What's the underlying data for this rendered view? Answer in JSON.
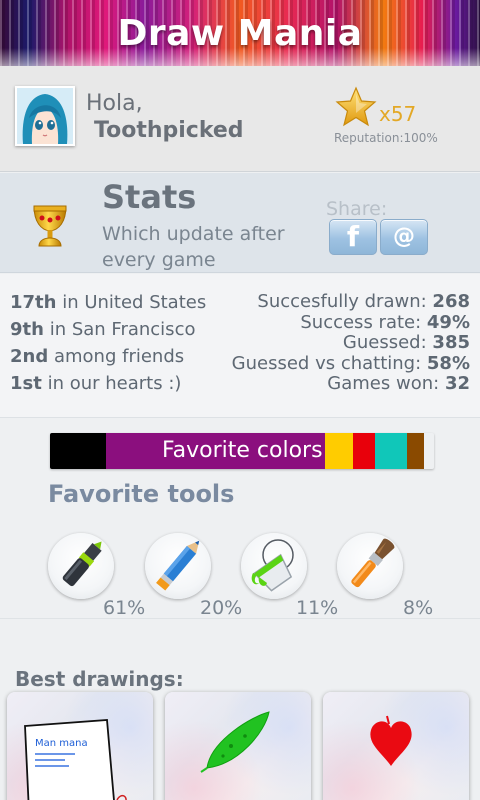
{
  "app": {
    "title": "Draw Mania"
  },
  "profile": {
    "greeting": "Hola,",
    "username": "Toothpicked",
    "reputation_count": "x57",
    "reputation_label": "Reputation:100%"
  },
  "stats": {
    "title": "Stats",
    "subtitle": "Which update after every game",
    "share_label": "Share:",
    "share_buttons": [
      {
        "label": "f",
        "icon": "facebook-icon"
      },
      {
        "label": "@",
        "icon": "email-icon"
      }
    ],
    "rankings": [
      {
        "rank": "17th",
        "text": "in United States"
      },
      {
        "rank": "9th",
        "text": "in San Francisco"
      },
      {
        "rank": "2nd",
        "text": "among friends"
      },
      {
        "rank": "1st",
        "text": "in our hearts :)"
      }
    ],
    "metrics": [
      {
        "label": "Succesfully drawn:",
        "value": "268"
      },
      {
        "label": "Success rate:",
        "value": "49%"
      },
      {
        "label": "Guessed:",
        "value": "385"
      },
      {
        "label": "Guessed vs chatting:",
        "value": "58%"
      },
      {
        "label": "Games won:",
        "value": "32"
      }
    ]
  },
  "favorite_colors": {
    "label": "Favorite colors",
    "swatches": [
      {
        "color": "#000000",
        "share": 0.145
      },
      {
        "color": "#8b0f7e",
        "share": 0.57
      },
      {
        "color": "#ffcc00",
        "share": 0.074
      },
      {
        "color": "#e8000b",
        "share": 0.057
      },
      {
        "color": "#10c7b9",
        "share": 0.083
      },
      {
        "color": "#8a4a00",
        "share": 0.046
      }
    ]
  },
  "favorite_tools": {
    "title": "Favorite tools",
    "tools": [
      {
        "icon": "marker-icon",
        "percent": "61%"
      },
      {
        "icon": "pencil-icon",
        "percent": "20%"
      },
      {
        "icon": "paint-bucket-icon",
        "percent": "11%"
      },
      {
        "icon": "paintbrush-icon",
        "percent": "8%"
      }
    ]
  },
  "best_drawings": {
    "title": "Best drawings:",
    "items": [
      {
        "subject": "paper-note-drawing",
        "caption": "Man mana"
      },
      {
        "subject": "green-leaf-drawing"
      },
      {
        "subject": "red-heart-drawing"
      }
    ]
  },
  "colors": {
    "text_dark": "#5e6873",
    "reputation_gold": "#e3a826",
    "share_blue": "#9ec2e2"
  }
}
